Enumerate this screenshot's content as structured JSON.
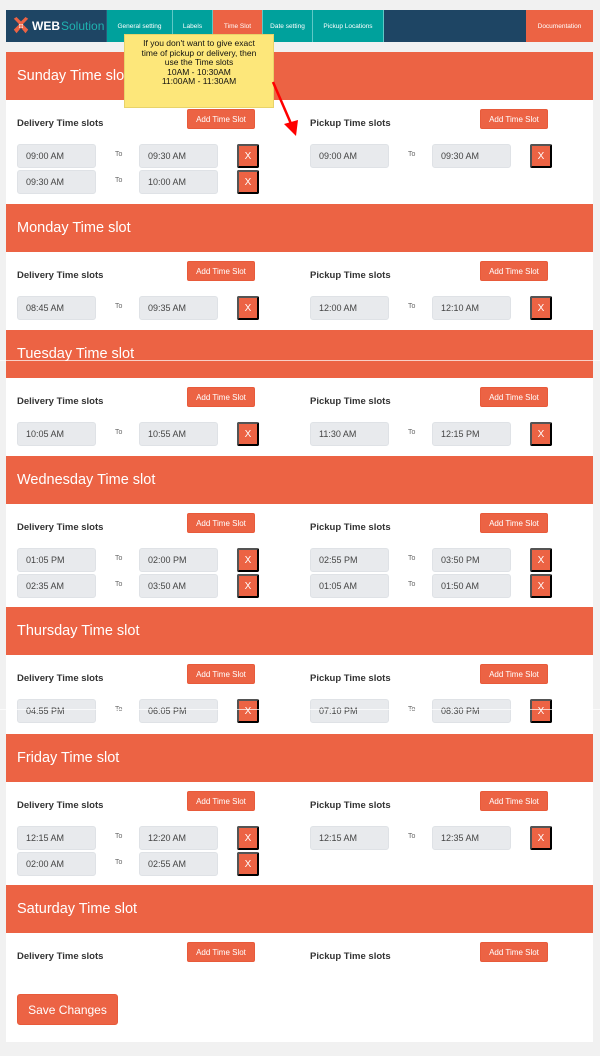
{
  "nav": {
    "logo": {
      "web": "WEB",
      "solution": "Solution"
    },
    "tabs": [
      {
        "label": "General setting",
        "active": false
      },
      {
        "label": "Labels",
        "active": false
      },
      {
        "label": "Time Slot",
        "active": true
      },
      {
        "label": "Date setting",
        "active": false
      },
      {
        "label": "Pickup Locations",
        "active": false
      }
    ],
    "documentation": "Documentation"
  },
  "note": {
    "lines": [
      "If you don't want to give exact",
      "time of pickup or delivery, then",
      "use the Time slots",
      "10AM - 10:30AM",
      "11:00AM - 11:30AM"
    ]
  },
  "labels": {
    "delivery": "Delivery Time slots",
    "pickup": "Pickup Time slots",
    "add": "Add Time Slot",
    "to": "To",
    "remove": "X",
    "save": "Save Changes"
  },
  "colors": {
    "accent": "#ec6344",
    "teal": "#00a19c",
    "navy": "#1e4564",
    "note": "#fde77a"
  },
  "days": [
    {
      "title": "Sunday Time slot",
      "delivery": [
        [
          "09:00 AM",
          "09:30 AM"
        ],
        [
          "09:30 AM",
          "10:00 AM"
        ]
      ],
      "pickup": [
        [
          "09:00 AM",
          "09:30 AM"
        ]
      ]
    },
    {
      "title": "Monday Time slot",
      "delivery": [
        [
          "08:45 AM",
          "09:35 AM"
        ]
      ],
      "pickup": [
        [
          "12:00 AM",
          "12:10 AM"
        ]
      ]
    },
    {
      "title": "Tuesday Time slot",
      "delivery": [
        [
          "10:05 AM",
          "10:55 AM"
        ]
      ],
      "pickup": [
        [
          "11:30 AM",
          "12:15 PM"
        ]
      ]
    },
    {
      "title": "Wednesday Time slot",
      "delivery": [
        [
          "01:05 PM",
          "02:00 PM"
        ],
        [
          "02:35 AM",
          "03:50 AM"
        ]
      ],
      "pickup": [
        [
          "02:55 PM",
          "03:50 PM"
        ],
        [
          "01:05 AM",
          "01:50 AM"
        ]
      ]
    },
    {
      "title": "Thursday Time slot",
      "delivery": [
        [
          "04:55 PM",
          "06:05 PM"
        ]
      ],
      "pickup": [
        [
          "07:10 PM",
          "08:30 PM"
        ]
      ]
    },
    {
      "title": "Friday Time slot",
      "delivery": [
        [
          "12:15 AM",
          "12:20 AM"
        ],
        [
          "02:00 AM",
          "02:55 AM"
        ]
      ],
      "pickup": [
        [
          "12:15 AM",
          "12:35 AM"
        ]
      ]
    },
    {
      "title": "Saturday Time slot",
      "delivery": [],
      "pickup": []
    }
  ]
}
